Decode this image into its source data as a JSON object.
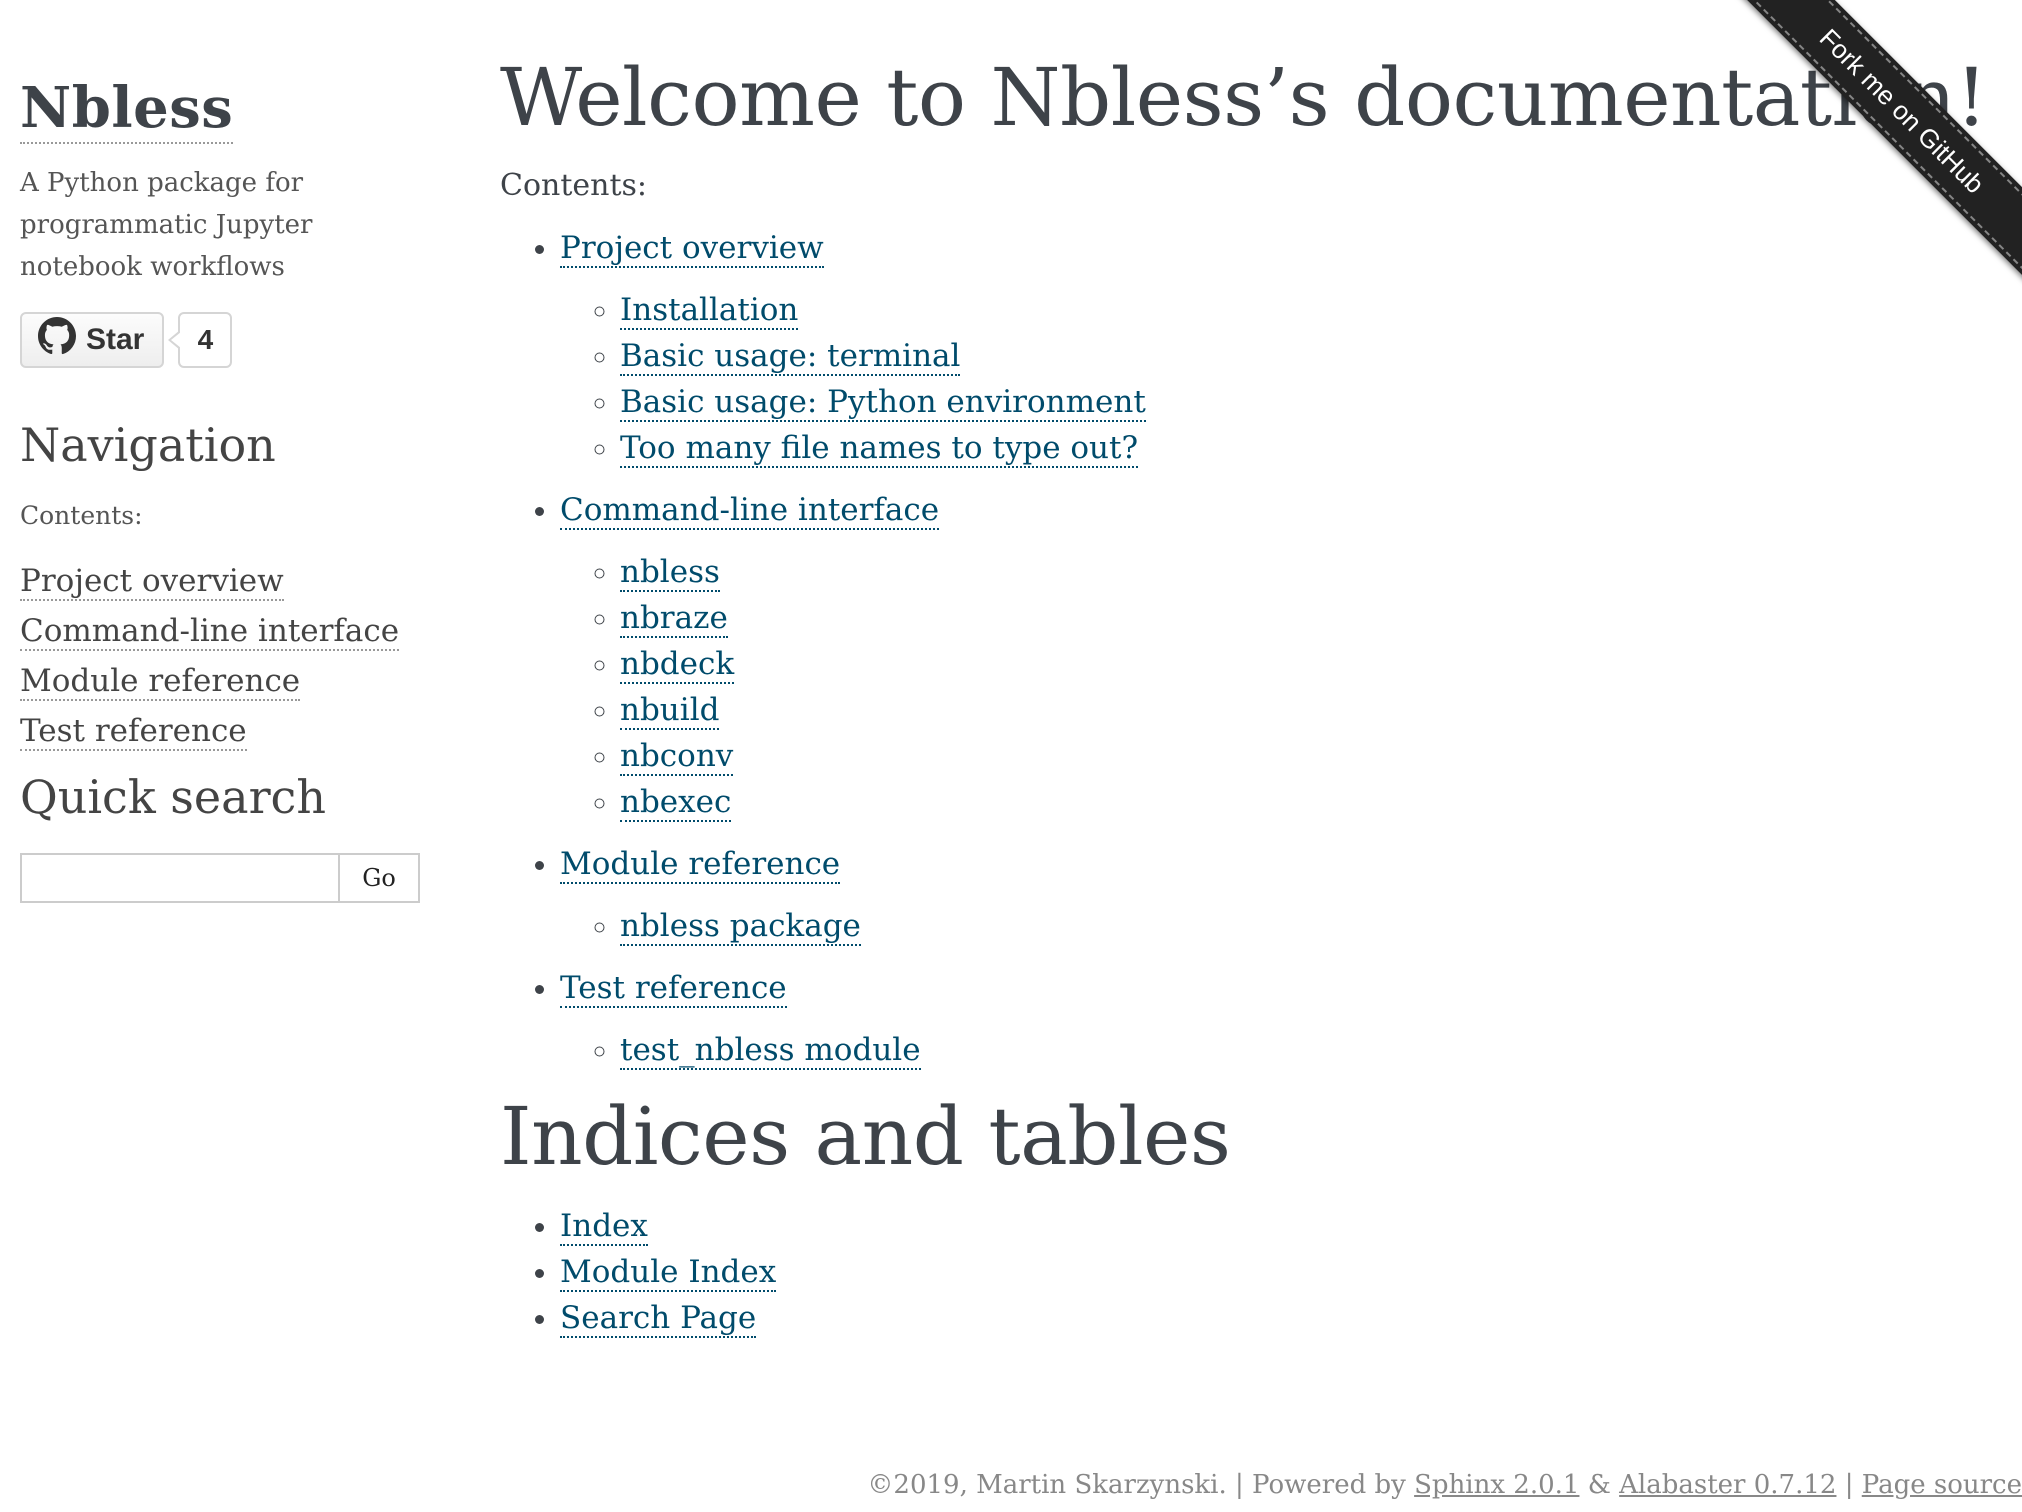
{
  "sidebar": {
    "logo": "Nbless",
    "tagline": "A Python package for programmatic Jupyter notebook workflows",
    "github": {
      "star_label": "Star",
      "star_count": "4",
      "icon": "github-icon"
    },
    "navigation_title": "Navigation",
    "contents_caption": "Contents:",
    "nav_items": [
      {
        "label": "Project overview"
      },
      {
        "label": "Command-line interface"
      },
      {
        "label": "Module reference"
      },
      {
        "label": "Test reference"
      }
    ],
    "search_title": "Quick search",
    "search_value": "",
    "search_button": "Go"
  },
  "main": {
    "title": "Welcome to Nbless’s documentation!",
    "contents_caption": "Contents:",
    "toc": [
      {
        "label": "Project overview",
        "children": [
          "Installation",
          "Basic usage: terminal",
          "Basic usage: Python environment",
          "Too many file names to type out?"
        ]
      },
      {
        "label": "Command-line interface",
        "children": [
          "nbless",
          "nbraze",
          "nbdeck",
          "nbuild",
          "nbconv",
          "nbexec"
        ]
      },
      {
        "label": "Module reference",
        "children": [
          "nbless package"
        ]
      },
      {
        "label": "Test reference",
        "children": [
          "test_nbless module"
        ]
      }
    ],
    "indices_title": "Indices and tables",
    "indices": [
      "Index",
      "Module Index",
      "Search Page"
    ]
  },
  "footer": {
    "copyright": "©2019, Martin Skarzynski.",
    "sep1": " | Powered by ",
    "sphinx": "Sphinx 2.0.1",
    "amp": " & ",
    "alabaster": "Alabaster 0.7.12",
    "sep2": " | ",
    "page_source": "Page source"
  },
  "ribbon": {
    "label": "Fork me on GitHub",
    "color": "#222222"
  },
  "colors": {
    "link": "#004b6b",
    "text": "#3e4349",
    "muted": "#888888"
  }
}
